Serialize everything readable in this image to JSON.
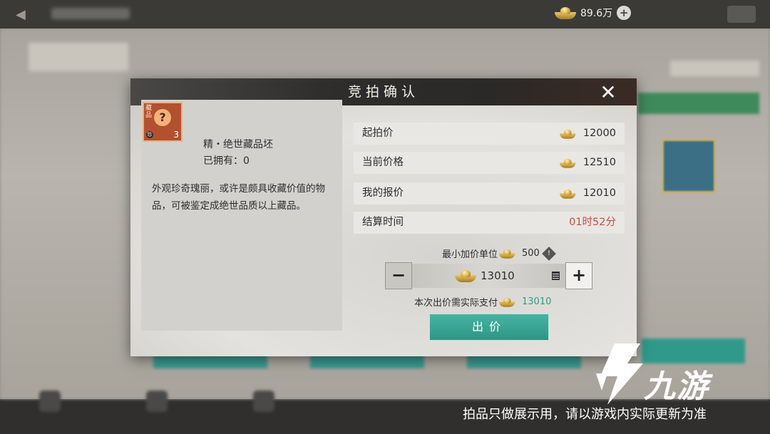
{
  "top_bar": {
    "currency_value": "89.6万",
    "add_icon": "plus-circle-icon"
  },
  "modal": {
    "title": "竞拍确认",
    "close_icon": "close-icon"
  },
  "item": {
    "icon_tag": "藏品",
    "icon_glyph": "?",
    "icon_count": "3",
    "icon_seal": "珍",
    "name": "精・绝世藏品坯",
    "owned": "已拥有：0",
    "description": "外观珍奇瑰丽，或许是颇具收藏价值的物品，可被鉴定成绝世品质以上藏品。"
  },
  "auction": {
    "rows": [
      {
        "label": "起拍价",
        "value": "12000"
      },
      {
        "label": "当前价格",
        "value": "12510"
      },
      {
        "label": "我的报价",
        "value": "12010"
      },
      {
        "label": "结算时间",
        "value": "01时52分"
      }
    ],
    "min_increment_label": "最小加价单位",
    "min_increment_value": "500",
    "bid_value": "13010",
    "minus_label": "−",
    "plus_label": "+",
    "actual_pay_label": "本次出价需实际支付",
    "actual_pay_value": "13010",
    "bid_button_label": "出价"
  },
  "watermark": {
    "brand": "九游",
    "notice": "拍品只做展示用，请以游戏内实际更新为准"
  },
  "colors": {
    "accent_teal": "#2f9c86",
    "timer_red": "#d04a3d",
    "ingot_gold": "#d7a83f"
  }
}
